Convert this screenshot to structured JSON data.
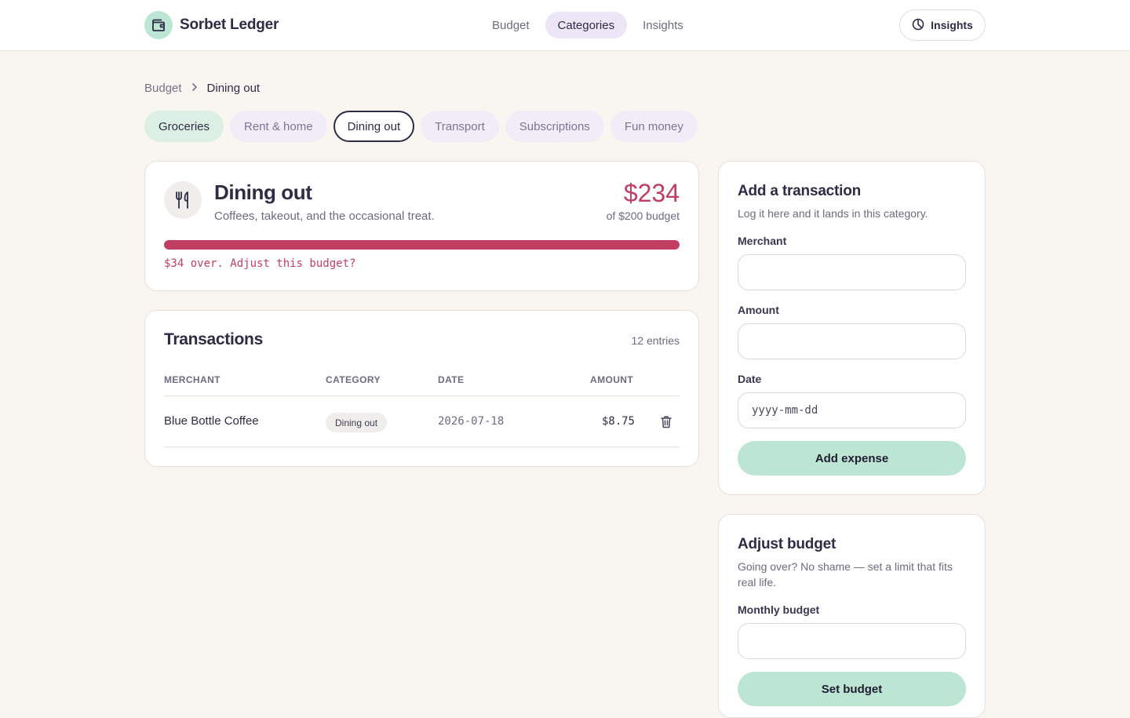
{
  "app": {
    "name": "Sorbet Ledger"
  },
  "topnav": {
    "items": [
      {
        "label": "Budget"
      },
      {
        "label": "Categories"
      },
      {
        "label": "Insights"
      }
    ]
  },
  "header": {
    "insights_button": "Insights"
  },
  "breadcrumb": {
    "parent": "Budget",
    "current": "Dining out"
  },
  "chips": [
    {
      "label": "Groceries"
    },
    {
      "label": "Rent & home"
    },
    {
      "label": "Dining out"
    },
    {
      "label": "Transport"
    },
    {
      "label": "Subscriptions"
    },
    {
      "label": "Fun money"
    }
  ],
  "category": {
    "title": "Dining out",
    "description": "Coffees, takeout, and the occasional treat.",
    "spent": "$234",
    "budget_text": "of $200 budget",
    "progress_fraction": 1.0,
    "over_message": "$34 over. Adjust this budget?"
  },
  "transactions": {
    "title": "Transactions",
    "count": "12 entries",
    "headers": {
      "merchant": "MERCHANT",
      "category": "CATEGORY",
      "date": "DATE",
      "amount": "AMOUNT"
    },
    "rows": [
      {
        "merchant": "Blue Bottle Coffee",
        "category": "Dining out",
        "date": "2026-07-18",
        "amount": "$8.75"
      }
    ]
  },
  "add_form": {
    "title": "Add a transaction",
    "subtitle": "Log it here and it lands in this category.",
    "merchant_label": "Merchant",
    "amount_label": "Amount",
    "date_label": "Date",
    "date_placeholder": "yyyy-mm-dd",
    "submit": "Add expense"
  },
  "budget_form": {
    "title": "Adjust budget",
    "subtitle": "Going over? No shame — set a limit that fits real life.",
    "label": "Monthly budget",
    "submit": "Set budget"
  },
  "colors": {
    "accent_mint": "#bce5d4",
    "over_budget": "#c13e62",
    "active_nav": "#ece6f7",
    "ink": "#2e2b45"
  },
  "icons": {
    "brand": "wallet-icon",
    "insights": "pie-chart-icon",
    "breadcrumb_separator": "chevron-right-icon",
    "category": "fork-knife-icon",
    "delete": "trash-icon"
  }
}
